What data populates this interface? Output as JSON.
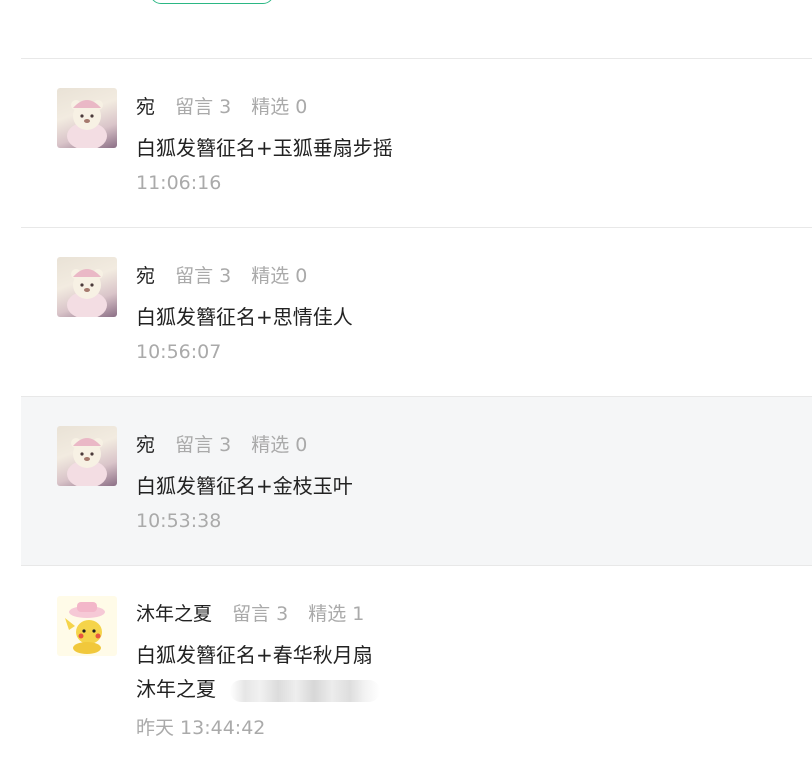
{
  "comments": [
    {
      "avatar_icon": "teddy-bear-avatar",
      "author": "宛",
      "messages_label": "留言 3",
      "selected_label": "精选 0",
      "text": "白狐发簪征名+玉狐垂扇步摇",
      "time": "11:06:16"
    },
    {
      "avatar_icon": "teddy-bear-avatar",
      "author": "宛",
      "messages_label": "留言 3",
      "selected_label": "精选 0",
      "text": "白狐发簪征名+思情佳人",
      "time": "10:56:07"
    },
    {
      "avatar_icon": "teddy-bear-avatar",
      "author": "宛",
      "messages_label": "留言 3",
      "selected_label": "精选 0",
      "text": "白狐发簪征名+金枝玉叶",
      "time": "10:53:38",
      "highlighted": true
    },
    {
      "avatar_icon": "pikachu-avatar",
      "author": "沐年之夏",
      "messages_label": "留言 3",
      "selected_label": "精选 1",
      "text": "白狐发簪征名+春华秋月扇",
      "reply_author": "沐年之夏",
      "time": "昨天 13:44:42"
    }
  ],
  "colors": {
    "accent_green": "#2bb784",
    "muted_text": "#aaaaaa",
    "highlight_bg": "#f5f6f7",
    "divider": "#e8e8e8"
  }
}
